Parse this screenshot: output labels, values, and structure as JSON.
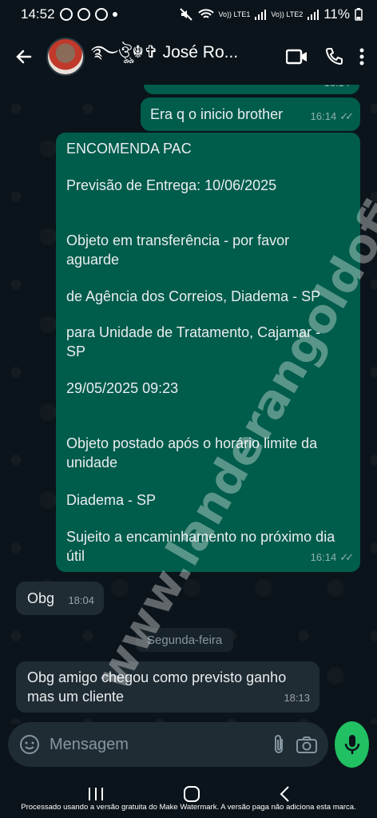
{
  "status_bar": {
    "time": "14:52",
    "signal_labels": [
      "Vo)) LTE1",
      "Vo)) LTE2"
    ],
    "battery": "11%"
  },
  "header": {
    "contact_name": "࿐ঔৣ☬✞ José Ro..."
  },
  "messages": {
    "partial_top_time": "16:14",
    "m1": {
      "text": "Era q o inicio brother",
      "time": "16:14"
    },
    "m2": {
      "lines": [
        "ENCOMENDA PAC",
        "Previsão de Entrega: 10/06/2025",
        "Objeto em transferência - por favor aguarde",
        "de Agência dos Correios, Diadema - SP",
        "para Unidade de Tratamento, Cajamar - SP",
        "29/05/2025 09:23",
        "Objeto postado após o horário limite da unidade",
        "Diadema - SP",
        "Sujeito a encaminhamento no próximo dia útil"
      ],
      "time": "16:14"
    },
    "m3": {
      "text": "Obg",
      "time": "18:04"
    },
    "day_separator": "Segunda-feira",
    "m4": {
      "text": "Obg amigo chegou como previsto ganho mas um cliente",
      "time": "18:13"
    }
  },
  "composer": {
    "placeholder": "Mensagem"
  },
  "overlay": {
    "watermark": "www.landerangoldoficial.com.br",
    "footer_note": "Processado usando a versão gratuita do Make Watermark. A versão paga não adiciona esta marca."
  },
  "colors": {
    "outgoing_bubble": "#005c4b",
    "incoming_bubble": "#202c33",
    "mic_button": "#21c063",
    "background": "#0b141a"
  }
}
